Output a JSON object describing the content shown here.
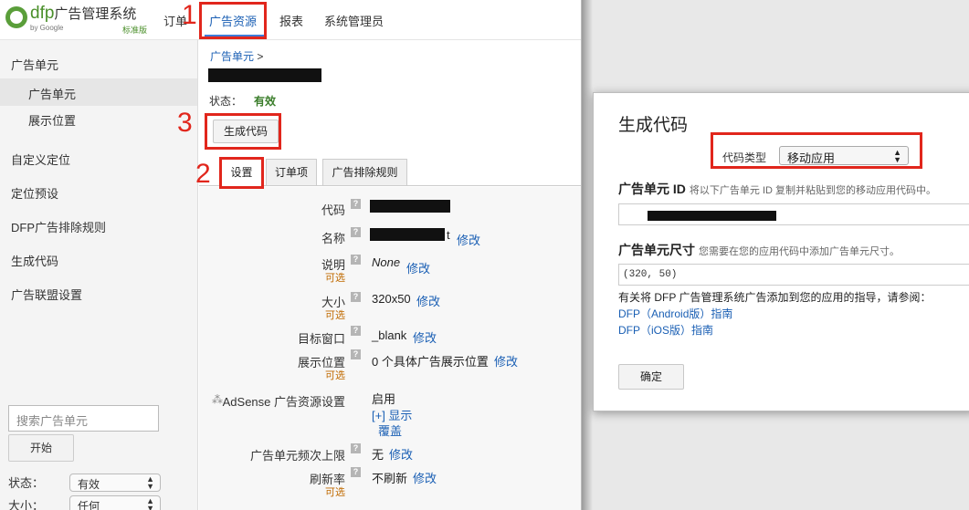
{
  "header": {
    "logo_brand": "dfp",
    "logo_brand_cn": "广告管理系统",
    "logo_by": "by Google",
    "logo_edition": "标准版",
    "nav": [
      {
        "label": "订单"
      },
      {
        "label": "广告资源"
      },
      {
        "label": "报表"
      },
      {
        "label": "系统管理员"
      }
    ],
    "active_nav": "广告资源"
  },
  "annotations": {
    "step1": "1",
    "step2": "2",
    "step3": "3"
  },
  "sidebar": {
    "section_title": "广告单元",
    "items": [
      {
        "label": "广告单元",
        "selected": true
      },
      {
        "label": "展示位置",
        "selected": false
      }
    ],
    "links": [
      {
        "label": "自定义定位"
      },
      {
        "label": "定位预设"
      },
      {
        "label": "DFP广告排除规则"
      },
      {
        "label": "生成代码"
      },
      {
        "label": "广告联盟设置"
      }
    ],
    "search_placeholder": "搜索广告单元",
    "start_button": "开始",
    "status_label": "状态：",
    "status_value": "有效",
    "size_label": "大小：",
    "size_value": "任何"
  },
  "main": {
    "breadcrumb": "广告单元",
    "breadcrumb_sep": ">",
    "status_label": "状态：",
    "status_value": "有效",
    "generate_code_button": "生成代码",
    "tabs": [
      {
        "label": "设置",
        "selected": true
      },
      {
        "label": "订单项",
        "selected": false
      },
      {
        "label": "广告排除规则",
        "selected": false
      }
    ],
    "fields": {
      "code_label": "代码",
      "name_label": "名称",
      "name_suffix": "t",
      "desc_label": "说明",
      "desc_value": "None",
      "size_label": "大小",
      "size_value": "320x50",
      "target_label": "目标窗口",
      "target_value": "_blank",
      "placement_label": "展示位置",
      "placement_value": "0 个具体广告展示位置",
      "adsense_label": "AdSense 广告资源设置",
      "adsense_value": "启用",
      "adsense_show": "[+] 显示",
      "adsense_override": "覆盖",
      "freq_label": "广告单元频次上限",
      "freq_value": "无",
      "refresh_label": "刷新率",
      "refresh_value": "不刷新",
      "optional": "可选",
      "edit": "修改",
      "help": "?"
    }
  },
  "dialog": {
    "title": "生成代码",
    "code_type_label": "代码类型",
    "code_type_value": "移动应用",
    "unit_id_title": "广告单元 ID",
    "unit_id_hint": "将以下广告单元 ID 复制并粘贴到您的移动应用代码中。",
    "unit_size_title": "广告单元尺寸",
    "unit_size_hint": "您需要在您的应用代码中添加广告单元尺寸。",
    "unit_size_value": "(320, 50)",
    "guide_text": "有关将 DFP 广告管理系统广告添加到您的应用的指导，请参阅：",
    "guide_android": "DFP（Android版）指南",
    "guide_ios": "DFP（iOS版）指南",
    "ok_button": "确定"
  },
  "colors": {
    "annotation_red": "#e1261c",
    "link_blue": "#1a5fb4",
    "status_green": "#3a7d2a",
    "optional_orange": "#c06a00"
  }
}
